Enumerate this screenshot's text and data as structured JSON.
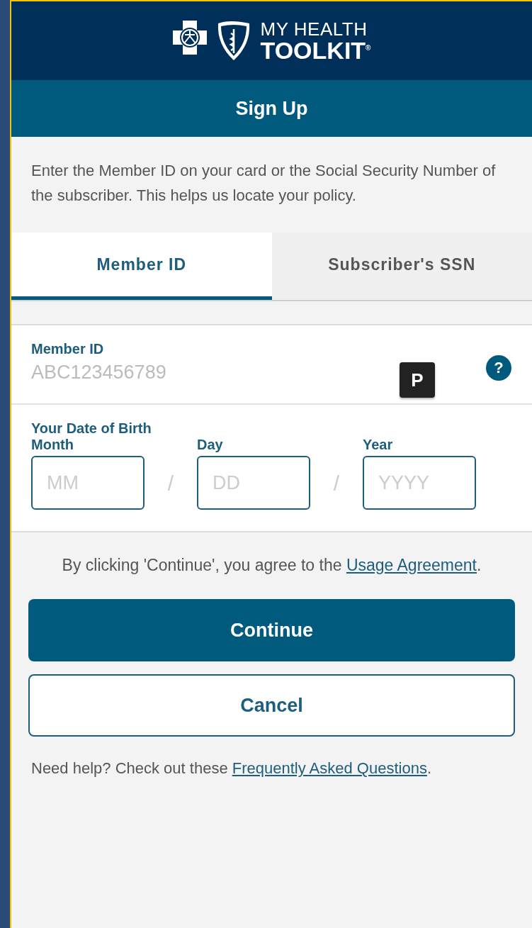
{
  "header": {
    "logo_lines": [
      "MY HEALTH",
      "TOOLKIT$^{®}$"
    ]
  },
  "title": "Sign Up",
  "intro": "Enter the Member ID on your card or the Social Security Number of the subscriber. This helps us locate your policy.",
  "tabs": [
    {
      "label": "Member ID",
      "selected": true
    },
    {
      "label": "Subscriber's SSN",
      "selected": false
    }
  ],
  "member_id": {
    "label": "Member ID",
    "placeholder": "ABC123456789",
    "help": "?",
    "badge": "P"
  },
  "date_of_birth": {
    "label": "Your Date of Birth",
    "separator": "/",
    "fields": [
      {
        "label": "Month",
        "placeholder": "MM"
      },
      {
        "label": "Day",
        "placeholder": "DD"
      },
      {
        "label": "Year",
        "placeholder": "YYYY"
      }
    ]
  },
  "agreement": {
    "text": "By clicking 'Continue', you agree to the ",
    "link": "Usage Agreement",
    "suffix": "."
  },
  "buttons": [
    {
      "label": "Continue",
      "kind": "primary"
    },
    {
      "label": "Cancel",
      "kind": "secondary"
    }
  ],
  "help": {
    "text": "Need help? Check out these ",
    "link": "Frequently Asked Questions",
    "suffix": "."
  }
}
